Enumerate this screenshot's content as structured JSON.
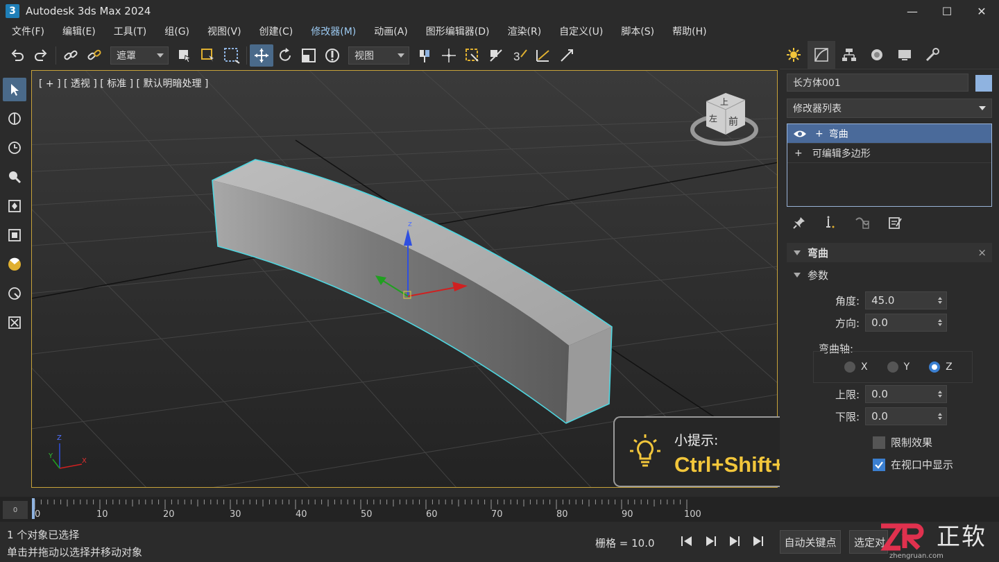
{
  "window": {
    "app_icon_text": "3",
    "title": "Autodesk 3ds Max 2024",
    "minimize": "—",
    "maximize": "☐",
    "close": "✕"
  },
  "menu": [
    "文件(F)",
    "编辑(E)",
    "工具(T)",
    "组(G)",
    "视图(V)",
    "创建(C)",
    "修改器(M)",
    "动画(A)",
    "图形编辑器(D)",
    "渲染(R)",
    "自定义(U)",
    "脚本(S)",
    "帮助(H)"
  ],
  "toolbar": {
    "selection_filter": "遮罩",
    "reference_coord": "视图"
  },
  "viewport": {
    "label": "[ + ] [ 透视 ] [ 标准 ] [ 默认明暗处理 ]",
    "viewcube": {
      "top": "上",
      "front": "前",
      "left": "左"
    },
    "gizmo_z": "z",
    "axis": {
      "x": "X",
      "y": "Y",
      "z": "Z"
    }
  },
  "command_panel": {
    "object_name": "长方体001",
    "object_color": "#8fb3e0",
    "modifier_list": "修改器列表",
    "stack": [
      {
        "label": "弯曲",
        "selected": true,
        "expand": "+"
      },
      {
        "label": "可编辑多边形",
        "selected": false,
        "expand": "+"
      }
    ],
    "rollout_title": "弯曲",
    "rollout_close": "×",
    "params_title": "参数",
    "angle_label": "角度:",
    "angle_value": "45.0",
    "direction_label": "方向:",
    "direction_value": "0.0",
    "bend_axis_label": "弯曲轴:",
    "axis_options": [
      "X",
      "Y",
      "Z"
    ],
    "axis_selected": "Z",
    "upper_label": "上限:",
    "upper_value": "0.0",
    "lower_label": "下限:",
    "lower_value": "0.0",
    "limit_effect_label": "限制效果",
    "limit_effect_checked": false,
    "show_in_viewport_label": "在视口中显示",
    "show_in_viewport_checked": true
  },
  "tip": {
    "title": "小提示:",
    "shortcut": "Ctrl+Shift+B"
  },
  "timeline": {
    "frame_button": "0",
    "ticks": [
      "0",
      "10",
      "20",
      "30",
      "40",
      "50",
      "60",
      "70",
      "80",
      "90",
      "100"
    ]
  },
  "status": {
    "line1": "1 个对象已选择",
    "line2": "单击并拖动以选择并移动对象",
    "grid": "栅格 = 10.0",
    "auto_key": "自动关键点",
    "set_key": "选定对"
  },
  "logo": {
    "mark": "ZR",
    "name": "正软",
    "url": "zhengruan.com"
  },
  "colors": {
    "selection_outline": "#4fd6e0",
    "viewport_border": "#c8a33a",
    "tip_text": "#f2c63b",
    "accent": "#3b7fd0"
  }
}
